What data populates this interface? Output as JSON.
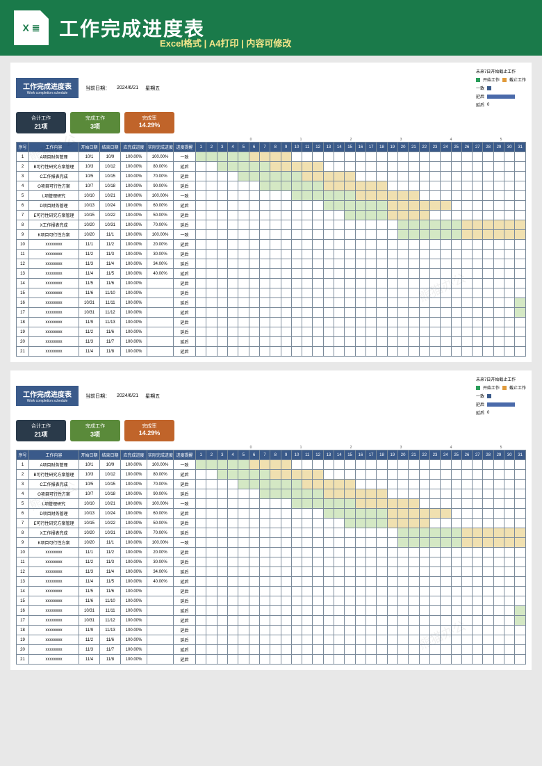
{
  "banner": {
    "icon_text": "X ≣",
    "title": "工作完成进度表",
    "subtitle": "Excel格式 | A4打印 | 内容可修改"
  },
  "sheet": {
    "title_cn": "工作完成进度表",
    "title_en": "Work completion schedule",
    "date_label": "当前日期：",
    "date_value": "2024/6/21",
    "weekday": "星期五",
    "legend_header": "未来7日开始截止工作",
    "legend_start": "开始工作",
    "legend_end": "截止工作",
    "legend_one": "一致",
    "legend_delay": "延后",
    "stats": [
      {
        "label": "合计工作",
        "value": "21项",
        "cls": "navy"
      },
      {
        "label": "完成工作",
        "value": "3项",
        "cls": "green"
      },
      {
        "label": "完成率",
        "value": "14.29%",
        "cls": "orange"
      }
    ],
    "headers": [
      "序号",
      "工作内容",
      "开始日期",
      "结束日期",
      "应完成进度",
      "实际完成进度",
      "进度提醒"
    ],
    "days": [
      "1",
      "2",
      "3",
      "4",
      "5",
      "6",
      "7",
      "8",
      "9",
      "10",
      "11",
      "12",
      "13",
      "14",
      "15",
      "16",
      "17",
      "18",
      "19",
      "20",
      "21",
      "22",
      "23",
      "24",
      "25",
      "26",
      "27",
      "28",
      "29",
      "30",
      "31"
    ],
    "rows": [
      {
        "seq": "1",
        "content": "A项目财务管理",
        "start": "10/1",
        "end": "10/9",
        "target": "100.00%",
        "actual": "100.00%",
        "remind": "一致",
        "gs": 1,
        "ge": 9
      },
      {
        "seq": "2",
        "content": "B可行性研究方案管理",
        "start": "10/3",
        "end": "10/12",
        "target": "100.00%",
        "actual": "80.00%",
        "remind": "延后",
        "gs": 3,
        "ge": 12
      },
      {
        "seq": "3",
        "content": "C工作报表完成",
        "start": "10/5",
        "end": "10/15",
        "target": "100.00%",
        "actual": "70.00%",
        "remind": "延后",
        "gs": 5,
        "ge": 15
      },
      {
        "seq": "4",
        "content": "O项目可行性方案",
        "start": "10/7",
        "end": "10/18",
        "target": "100.00%",
        "actual": "90.00%",
        "remind": "延后",
        "gs": 7,
        "ge": 18
      },
      {
        "seq": "5",
        "content": "L项管理研究",
        "start": "10/10",
        "end": "10/21",
        "target": "100.00%",
        "actual": "100.00%",
        "remind": "一致",
        "gs": 10,
        "ge": 21
      },
      {
        "seq": "6",
        "content": "D项目财务管理",
        "start": "10/13",
        "end": "10/24",
        "target": "100.00%",
        "actual": "60.00%",
        "remind": "延后",
        "gs": 13,
        "ge": 24
      },
      {
        "seq": "7",
        "content": "E可行性研究方案管理",
        "start": "10/15",
        "end": "10/22",
        "target": "100.00%",
        "actual": "50.00%",
        "remind": "延后",
        "gs": 15,
        "ge": 22
      },
      {
        "seq": "8",
        "content": "X工作报表完成",
        "start": "10/20",
        "end": "10/31",
        "target": "100.00%",
        "actual": "70.00%",
        "remind": "延后",
        "gs": 20,
        "ge": 31
      },
      {
        "seq": "9",
        "content": "K项目可行性方案",
        "start": "10/20",
        "end": "11/1",
        "target": "100.00%",
        "actual": "100.00%",
        "remind": "一致",
        "gs": 20,
        "ge": 31
      },
      {
        "seq": "10",
        "content": "xxxxxxxx",
        "start": "11/1",
        "end": "11/2",
        "target": "100.00%",
        "actual": "20.00%",
        "remind": "延后",
        "gs": 0,
        "ge": 0
      },
      {
        "seq": "11",
        "content": "xxxxxxxx",
        "start": "11/2",
        "end": "11/3",
        "target": "100.00%",
        "actual": "30.00%",
        "remind": "延后",
        "gs": 0,
        "ge": 0
      },
      {
        "seq": "12",
        "content": "xxxxxxxx",
        "start": "11/3",
        "end": "11/4",
        "target": "100.00%",
        "actual": "34.00%",
        "remind": "延后",
        "gs": 0,
        "ge": 0
      },
      {
        "seq": "13",
        "content": "xxxxxxxx",
        "start": "11/4",
        "end": "11/5",
        "target": "100.00%",
        "actual": "40.00%",
        "remind": "延后",
        "gs": 0,
        "ge": 0
      },
      {
        "seq": "14",
        "content": "xxxxxxxx",
        "start": "11/5",
        "end": "11/6",
        "target": "100.00%",
        "actual": "",
        "remind": "延后",
        "gs": 0,
        "ge": 0
      },
      {
        "seq": "15",
        "content": "xxxxxxxx",
        "start": "11/6",
        "end": "11/10",
        "target": "100.00%",
        "actual": "",
        "remind": "延后",
        "gs": 0,
        "ge": 0
      },
      {
        "seq": "16",
        "content": "xxxxxxxx",
        "start": "10/31",
        "end": "11/11",
        "target": "100.00%",
        "actual": "",
        "remind": "延后",
        "gs": 31,
        "ge": 31
      },
      {
        "seq": "17",
        "content": "xxxxxxxx",
        "start": "10/31",
        "end": "11/12",
        "target": "100.00%",
        "actual": "",
        "remind": "延后",
        "gs": 31,
        "ge": 31
      },
      {
        "seq": "18",
        "content": "xxxxxxxx",
        "start": "11/9",
        "end": "11/13",
        "target": "100.00%",
        "actual": "",
        "remind": "延后",
        "gs": 0,
        "ge": 0
      },
      {
        "seq": "19",
        "content": "xxxxxxxx",
        "start": "11/2",
        "end": "11/6",
        "target": "100.00%",
        "actual": "",
        "remind": "延后",
        "gs": 0,
        "ge": 0
      },
      {
        "seq": "20",
        "content": "xxxxxxxx",
        "start": "11/3",
        "end": "11/7",
        "target": "100.00%",
        "actual": "",
        "remind": "延后",
        "gs": 0,
        "ge": 0
      },
      {
        "seq": "21",
        "content": "xxxxxxxx",
        "start": "11/4",
        "end": "11/8",
        "target": "100.00%",
        "actual": "",
        "remind": "延后",
        "gs": 0,
        "ge": 0
      }
    ]
  },
  "chart_data": {
    "type": "bar",
    "title": "未来7日开始截止工作",
    "categories": [
      "一致",
      "延后"
    ],
    "series": [
      {
        "name": "开始工作",
        "values": [
          0,
          0
        ]
      },
      {
        "name": "截止工作",
        "values": [
          0,
          0
        ]
      }
    ],
    "xlim": [
      0,
      5
    ],
    "xticks": [
      0,
      1,
      2,
      3,
      4,
      5
    ]
  },
  "watermark": "熊猫办公"
}
